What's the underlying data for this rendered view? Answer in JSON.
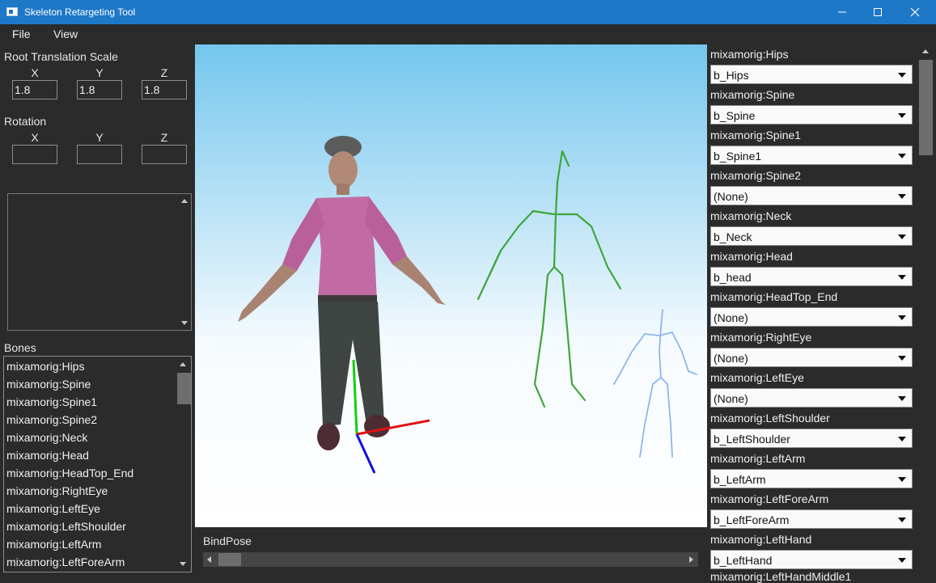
{
  "window": {
    "title": "Skeleton Retargeting Tool"
  },
  "menu": [
    {
      "label": "File"
    },
    {
      "label": "View"
    }
  ],
  "root_translation": {
    "label": "Root Translation Scale",
    "x_label": "X",
    "y_label": "Y",
    "z_label": "Z",
    "x_value": "1.8",
    "y_value": "1.8",
    "z_value": "1.8"
  },
  "rotation": {
    "label": "Rotation",
    "x_label": "X",
    "y_label": "Y",
    "z_label": "Z",
    "x_value": "",
    "y_value": "",
    "z_value": ""
  },
  "bones": {
    "label": "Bones",
    "items": [
      "mixamorig:Hips",
      "mixamorig:Spine",
      "mixamorig:Spine1",
      "mixamorig:Spine2",
      "mixamorig:Neck",
      "mixamorig:Head",
      "mixamorig:HeadTop_End",
      "mixamorig:RightEye",
      "mixamorig:LeftEye",
      "mixamorig:LeftShoulder",
      "mixamorig:LeftArm",
      "mixamorig:LeftForeArm"
    ]
  },
  "animation": {
    "label": "BindPose"
  },
  "mappings": [
    {
      "source": "mixamorig:Hips",
      "target": "b_Hips"
    },
    {
      "source": "mixamorig:Spine",
      "target": "b_Spine"
    },
    {
      "source": "mixamorig:Spine1",
      "target": "b_Spine1"
    },
    {
      "source": "mixamorig:Spine2",
      "target": "(None)"
    },
    {
      "source": "mixamorig:Neck",
      "target": "b_Neck"
    },
    {
      "source": "mixamorig:Head",
      "target": "b_head"
    },
    {
      "source": "mixamorig:HeadTop_End",
      "target": "(None)"
    },
    {
      "source": "mixamorig:RightEye",
      "target": "(None)"
    },
    {
      "source": "mixamorig:LeftEye",
      "target": "(None)"
    },
    {
      "source": "mixamorig:LeftShoulder",
      "target": "b_LeftShoulder"
    },
    {
      "source": "mixamorig:LeftArm",
      "target": "b_LeftArm"
    },
    {
      "source": "mixamorig:LeftForeArm",
      "target": "b_LeftForeArm"
    },
    {
      "source": "mixamorig:LeftHand",
      "target": "b_LeftHand"
    }
  ],
  "mappings_next_partial": "mixamorig:LeftHandMiddle1",
  "colors": {
    "titlebar": "#1e78c8",
    "background": "#2b2b2b",
    "skeleton_green": "#3fa63a",
    "skeleton_blue": "#8fb6e8",
    "axis_x": "#e01010",
    "axis_y": "#10d010",
    "axis_z": "#1010e0"
  }
}
